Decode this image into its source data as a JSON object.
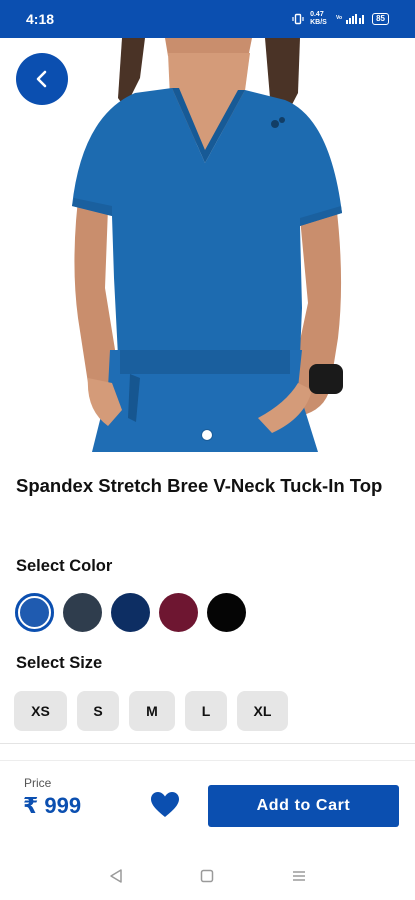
{
  "status_bar": {
    "time": "4:18",
    "indicators": [
      "vibrate-icon",
      "data-speed",
      "volte-icon",
      "signal-icon",
      "battery-icon"
    ],
    "data_speed": "0.47 KB/S",
    "battery": "85"
  },
  "product": {
    "title": "Spandex Stretch Bree V-Neck Tuck-In Top",
    "image_icon": "product-photo",
    "carousel_page": 1,
    "carousel_total": 1
  },
  "color_section": {
    "label": "Select Color",
    "options": [
      {
        "color": "#1f5bb0",
        "selected": true
      },
      {
        "color": "#2f3d4d",
        "selected": false
      },
      {
        "color": "#0d2e63",
        "selected": false
      },
      {
        "color": "#6e1631",
        "selected": false
      },
      {
        "color": "#050505",
        "selected": false
      }
    ]
  },
  "size_section": {
    "label": "Select Size",
    "options": [
      "XS",
      "S",
      "M",
      "L",
      "XL"
    ]
  },
  "footer": {
    "price_label": "Price",
    "price_value": "₹ 999",
    "wishlist_icon": "heart-icon",
    "cta_label": "Add to Cart"
  },
  "nav": {
    "back": "back-triangle-icon",
    "home": "home-square-icon",
    "menu": "menu-lines-icon"
  },
  "colors": {
    "brand": "#0b4fb0",
    "chip_bg": "#e6e6e6"
  }
}
